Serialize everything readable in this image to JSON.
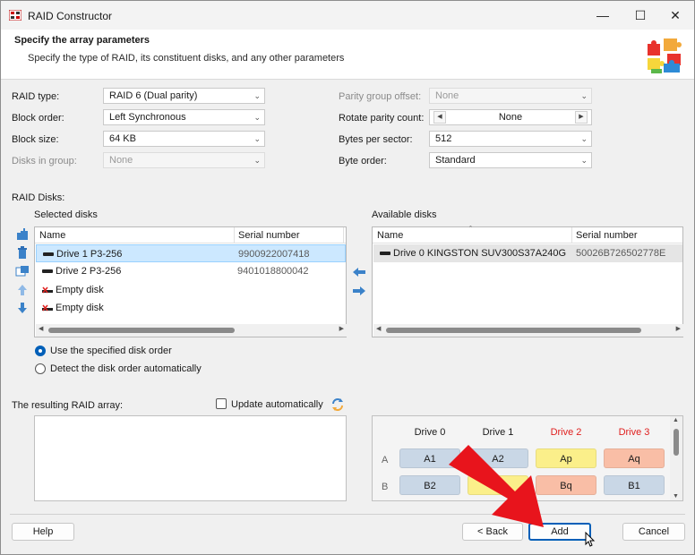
{
  "window": {
    "title": "RAID Constructor",
    "minimize_icon": "minimize-icon",
    "maximize_icon": "maximize-icon",
    "close_icon": "close-icon"
  },
  "header": {
    "title": "Specify the array parameters",
    "subtitle": "Specify the type of RAID, its constituent disks, and any other parameters",
    "icon": "puzzle-icon"
  },
  "params": {
    "raid_type": {
      "label": "RAID type:",
      "value": "RAID 6 (Dual parity)"
    },
    "block_order": {
      "label": "Block order:",
      "value": "Left Synchronous"
    },
    "block_size": {
      "label": "Block size:",
      "value": "64 KB"
    },
    "disks_in_group": {
      "label": "Disks in group:",
      "value": "None"
    },
    "parity_group_offset": {
      "label": "Parity group offset:",
      "value": "None"
    },
    "rotate_parity_count": {
      "label": "Rotate parity count:",
      "value": "None"
    },
    "bytes_per_sector": {
      "label": "Bytes per sector:",
      "value": "512"
    },
    "byte_order": {
      "label": "Byte order:",
      "value": "Standard"
    }
  },
  "raid_disks": {
    "label": "RAID Disks:",
    "selected": {
      "label": "Selected disks",
      "columns": [
        "Name",
        "Serial number"
      ],
      "rows": [
        {
          "name": "Drive 1 P3-256",
          "serial": "9900922007418",
          "icon": "drive-icon"
        },
        {
          "name": "Drive 2 P3-256",
          "serial": "9401018800042",
          "icon": "drive-icon"
        },
        {
          "name": "Empty disk",
          "serial": "",
          "icon": "empty-disk-icon"
        },
        {
          "name": "Empty disk",
          "serial": "",
          "icon": "empty-disk-icon"
        }
      ]
    },
    "available": {
      "label": "Available disks",
      "columns": [
        "Name",
        "Serial number"
      ],
      "rows": [
        {
          "name": "Drive 0 KINGSTON SUV300S37A240G",
          "serial": "50026B726502778E",
          "icon": "drive-icon"
        }
      ]
    },
    "order_options": [
      {
        "label": "Use the specified disk order",
        "checked": true
      },
      {
        "label": "Detect the disk order automatically",
        "checked": false
      }
    ]
  },
  "result": {
    "label": "The resulting RAID array:",
    "update_label": "Update automatically",
    "update_checked": false,
    "refresh_icon": "refresh-icon"
  },
  "layout_grid": {
    "drives": [
      {
        "label": "Drive 0",
        "color": "#1a1a1a"
      },
      {
        "label": "Drive 1",
        "color": "#1a1a1a"
      },
      {
        "label": "Drive 2",
        "color": "#e0201f"
      },
      {
        "label": "Drive 3",
        "color": "#e0201f"
      }
    ],
    "rows": [
      {
        "label": "A",
        "cells": [
          {
            "text": "A1",
            "color": "#c9d7e6"
          },
          {
            "text": "A2",
            "color": "#c9d7e6"
          },
          {
            "text": "Ap",
            "color": "#fbef8a"
          },
          {
            "text": "Aq",
            "color": "#f9bea6"
          }
        ]
      },
      {
        "label": "B",
        "cells": [
          {
            "text": "B2",
            "color": "#c9d7e6"
          },
          {
            "text": "",
            "color": "#fbef8a"
          },
          {
            "text": "Bq",
            "color": "#f9bea6"
          },
          {
            "text": "B1",
            "color": "#c9d7e6"
          }
        ]
      }
    ]
  },
  "footer": {
    "help": "Help",
    "back": "< Back",
    "add": "Add",
    "cancel": "Cancel"
  },
  "colors": {
    "accent": "#005fb8",
    "arrow": "#e8141c",
    "selection": "#cce8ff"
  }
}
